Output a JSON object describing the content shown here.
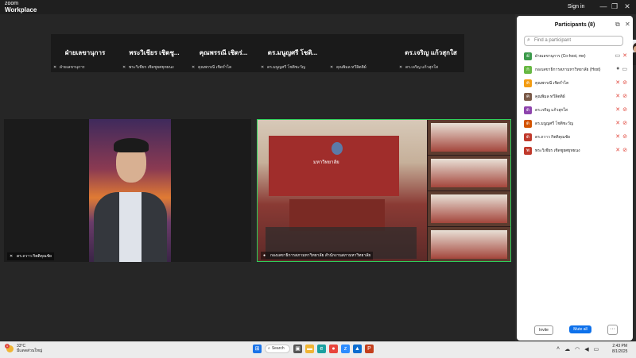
{
  "app": {
    "brand_small": "zoom",
    "brand": "Workplace",
    "sign_in": "Sign in"
  },
  "window_controls": {
    "minimize": "—",
    "restore": "❐",
    "close": "✕"
  },
  "gallery": [
    {
      "name": "ฝ่ายเลขานุการ",
      "footer": "ฝ่ายเลขานุการ"
    },
    {
      "name": "พระวิเชียร เชิดชู...",
      "footer": "พระวิเชียร เชิดชูยศยุทธนง"
    },
    {
      "name": "คุณพรรณี เชิดร่...",
      "footer": "คุณพรรณี เชิดร่ำไค"
    },
    {
      "name": "ดร.มนูญศรี โชติ...",
      "footer": "ดร.มนูญศรี โชติชะวัญ"
    },
    {
      "name": "",
      "footer": "คุณพิมล ทวีลิตติผ์"
    },
    {
      "name": "ดร.เจริญ แก้วสุกใส",
      "footer": "ดร.เจริญ แก้วสุกใส"
    }
  ],
  "videos": {
    "left_label": "ดร.ถวาว กิตติคุณชัย",
    "right_label": "กองเลขาธิการสภามหาวิทยาลัย สำนักงานสภามหาวิทยาลัย",
    "room_sign": "มหาวิทยาลัย"
  },
  "panel": {
    "title": "Participants (8)",
    "search_placeholder": "Find a participant",
    "participants": [
      {
        "name": "ฝ่ายเลขานุการ (Co-host, me)",
        "initial": "ฝ",
        "color": "#3b9a4a"
      },
      {
        "name": "กองเลขาธิการสภามหาวิทยาลัย (Host)",
        "initial": "ก",
        "color": "#67b843"
      },
      {
        "name": "คุณพรรณี เชิดร่ำไค",
        "initial": "ค",
        "color": "#f39c12"
      },
      {
        "name": "คุณพิมล ทวีลิตติผ์",
        "initial": "ค",
        "color": "#7a5a48"
      },
      {
        "name": "ดร.เจริญ แก้วสุกใส",
        "initial": "ด",
        "color": "#8e44ad"
      },
      {
        "name": "ดร.มนูญศรี โชติชะวัญ",
        "initial": "ด",
        "color": "#d35400"
      },
      {
        "name": "ดร.ถวาว กิตติคุณชัย",
        "initial": "ด",
        "color": "#c0392b"
      },
      {
        "name": "พระวิเชียร เชิดชูยศยุทธนง",
        "initial": "พ",
        "color": "#c0392b"
      }
    ],
    "invite": "Invite",
    "mute_all": "Mute all",
    "more": "···"
  },
  "taskbar": {
    "temperature": "33°C",
    "weather_text": "มีแดดส่วนใหญ่",
    "weather_badge": "1",
    "search": "Search",
    "time": "2:43 PM",
    "date": "8/1/2025"
  }
}
